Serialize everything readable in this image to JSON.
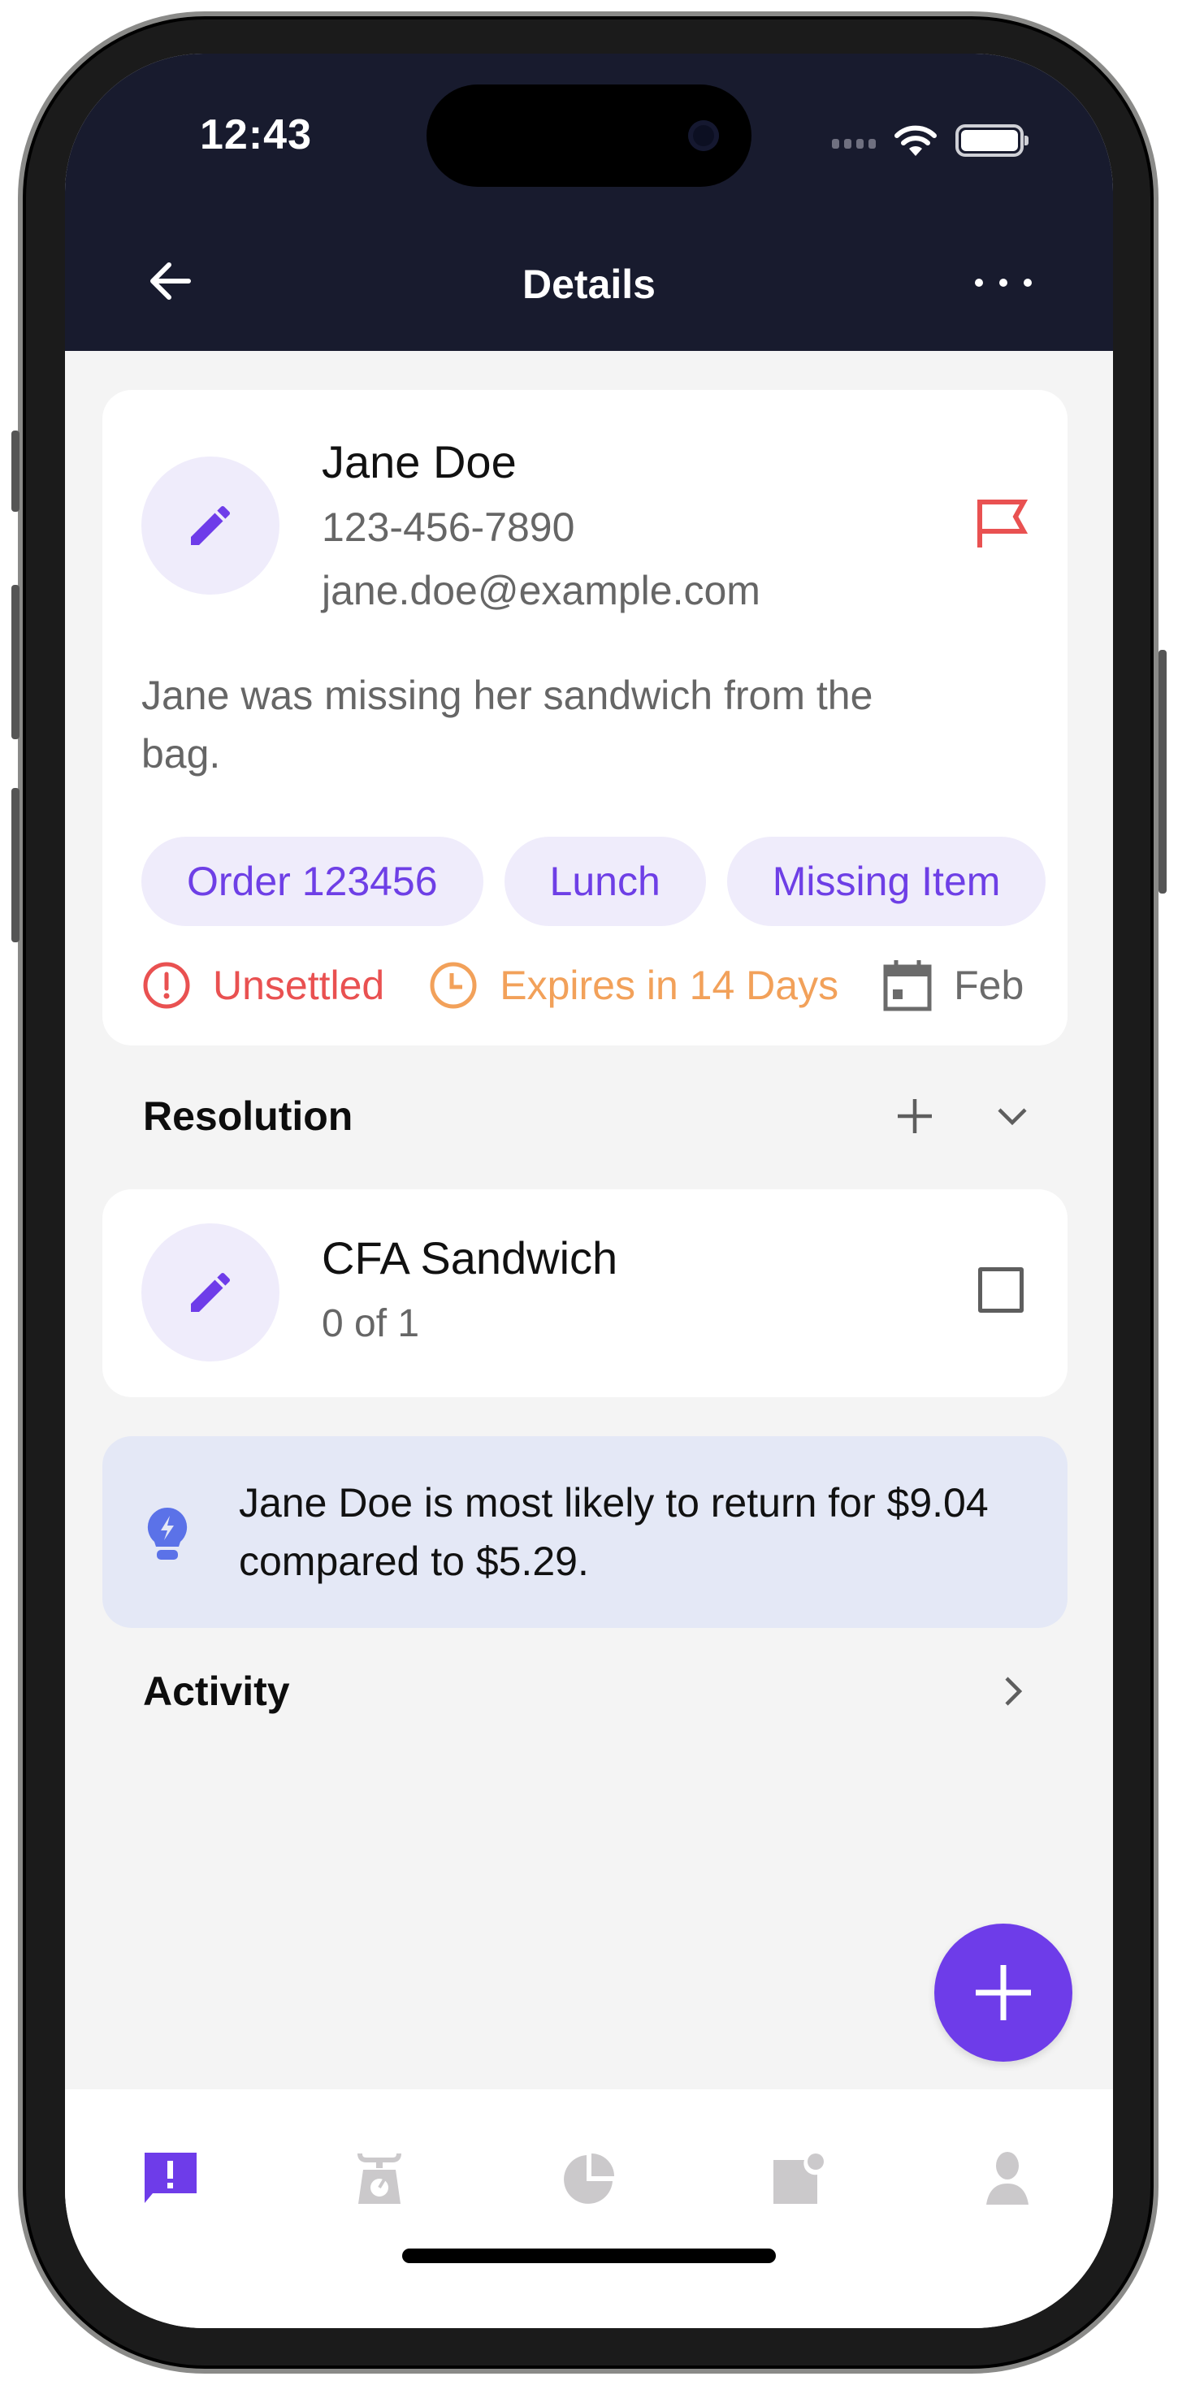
{
  "status_bar": {
    "time": "12:43",
    "icons": [
      "signal-dots-icon",
      "wifi-icon",
      "battery-icon"
    ]
  },
  "nav": {
    "title": "Details",
    "back_icon": "arrow-left-icon",
    "more_icon": "more-horizontal-icon"
  },
  "customer": {
    "avatar_icon": "pencil-icon",
    "name": "Jane Doe",
    "phone": "123-456-7890",
    "email": "jane.doe@example.com",
    "flag_icon": "flag-icon",
    "description": "Jane was missing her sandwich from the bag.",
    "tags": [
      "Order 123456",
      "Lunch",
      "Missing Item"
    ],
    "statuses": [
      {
        "icon": "alert-circle-icon",
        "label": "Unsettled",
        "color": "#e95151"
      },
      {
        "icon": "clock-icon",
        "label": "Expires in 14 Days",
        "color": "#f2a15a"
      },
      {
        "icon": "calendar-icon",
        "label": "Feb",
        "color": "#6b6b6b"
      }
    ]
  },
  "resolution": {
    "title": "Resolution",
    "add_icon": "plus-icon",
    "collapse_icon": "chevron-down-icon",
    "items": [
      {
        "icon": "pencil-icon",
        "title": "CFA Sandwich",
        "progress": "0 of 1",
        "checked": false
      }
    ]
  },
  "insight": {
    "icon": "lightbulb-bolt-icon",
    "text": "Jane Doe is most likely to return for $9.04 compared to $5.29."
  },
  "activity": {
    "title": "Activity",
    "chevron_icon": "chevron-right-icon"
  },
  "fab": {
    "icon": "plus-icon"
  },
  "tabbar": {
    "active_index": 0,
    "tabs": [
      {
        "name": "issues",
        "icon": "alert-message-icon"
      },
      {
        "name": "scale",
        "icon": "scale-icon"
      },
      {
        "name": "reports",
        "icon": "pie-chart-icon"
      },
      {
        "name": "notifications",
        "icon": "notification-card-icon"
      },
      {
        "name": "profile",
        "icon": "person-icon"
      }
    ]
  },
  "colors": {
    "accent": "#6e3ce9",
    "header_bg": "#181b2e",
    "tag_bg": "#efecfb",
    "insight_bg": "#e4e8f6",
    "danger": "#e95151",
    "warning": "#f2a15a"
  }
}
